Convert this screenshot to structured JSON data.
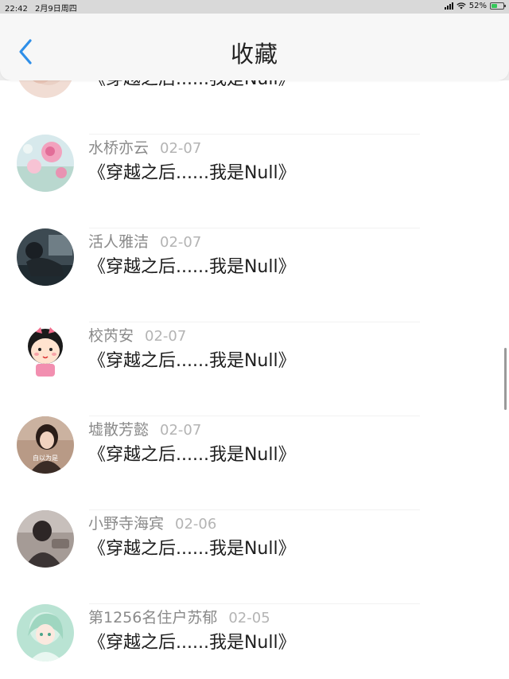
{
  "status_bar": {
    "time": "22:42",
    "date": "2月9日周四",
    "battery": "52%",
    "battery_level": 0.52
  },
  "header": {
    "back_icon": "chevron-left-icon",
    "title": "收藏",
    "accent_color": "#2f8fe8"
  },
  "list": {
    "items": [
      {
        "user": "",
        "date": "",
        "title": "《穿越之后......我是Null》",
        "avatar": "avatar-peach-flower"
      },
      {
        "user": "水桥亦云",
        "date": "02-07",
        "title": "《穿越之后......我是Null》",
        "avatar": "avatar-pink-flowers"
      },
      {
        "user": "活人雅洁",
        "date": "02-07",
        "title": "《穿越之后......我是Null》",
        "avatar": "avatar-dark-photo"
      },
      {
        "user": "校芮安",
        "date": "02-07",
        "title": "《穿越之后......我是Null》",
        "avatar": "avatar-cartoon-girl"
      },
      {
        "user": "墟散芳懿",
        "date": "02-07",
        "title": "《穿越之后......我是Null》",
        "avatar": "avatar-girl-photo",
        "avatar_caption": "自以为是"
      },
      {
        "user": "小野寺海宾",
        "date": "02-06",
        "title": "《穿越之后......我是Null》",
        "avatar": "avatar-grey-photo"
      },
      {
        "user": "第1256名住户苏郁",
        "date": "02-05",
        "title": "《穿越之后......我是Null》",
        "avatar": "avatar-anime-girl"
      }
    ]
  }
}
